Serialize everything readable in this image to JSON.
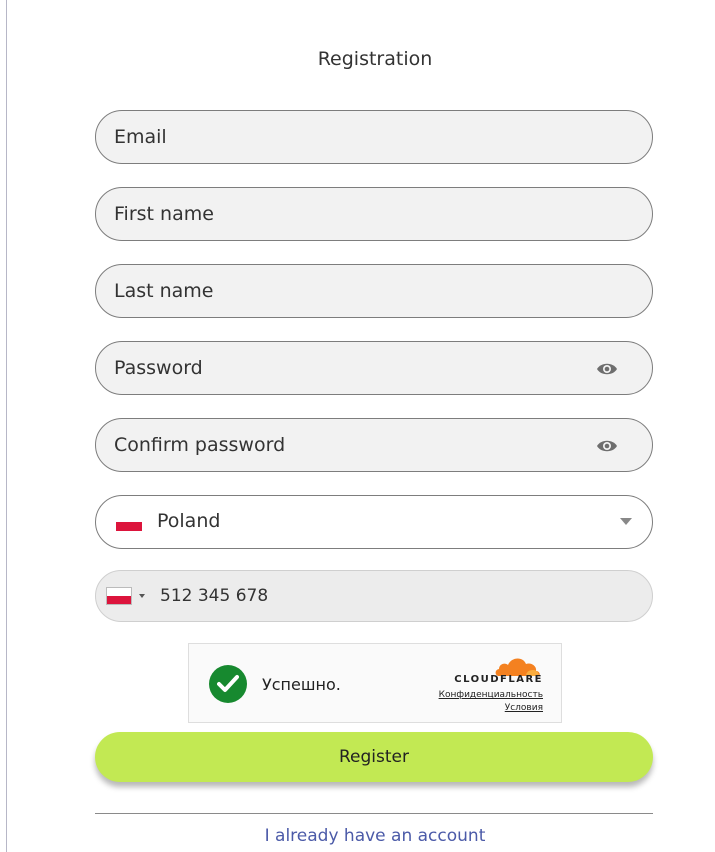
{
  "form": {
    "title": "Registration",
    "email_placeholder": "Email",
    "first_name_placeholder": "First name",
    "last_name_placeholder": "Last name",
    "password_placeholder": "Password",
    "confirm_password_placeholder": "Confirm password",
    "country": {
      "selected": "Poland",
      "flag": "poland-flag"
    },
    "phone": {
      "flag": "poland-flag",
      "value": "512 345 678"
    },
    "captcha": {
      "status": "Успешно.",
      "brand": "CLOUDFLARE",
      "privacy_link": "Конфиденциальность",
      "terms_link": "Условия"
    },
    "register_label": "Register",
    "login_link": "I already have an account"
  },
  "colors": {
    "accent": "#c2e953",
    "link": "#4b5aa8",
    "success": "#17892f",
    "cloudflare_orange": "#f48120",
    "flag_red": "#dc143c"
  }
}
